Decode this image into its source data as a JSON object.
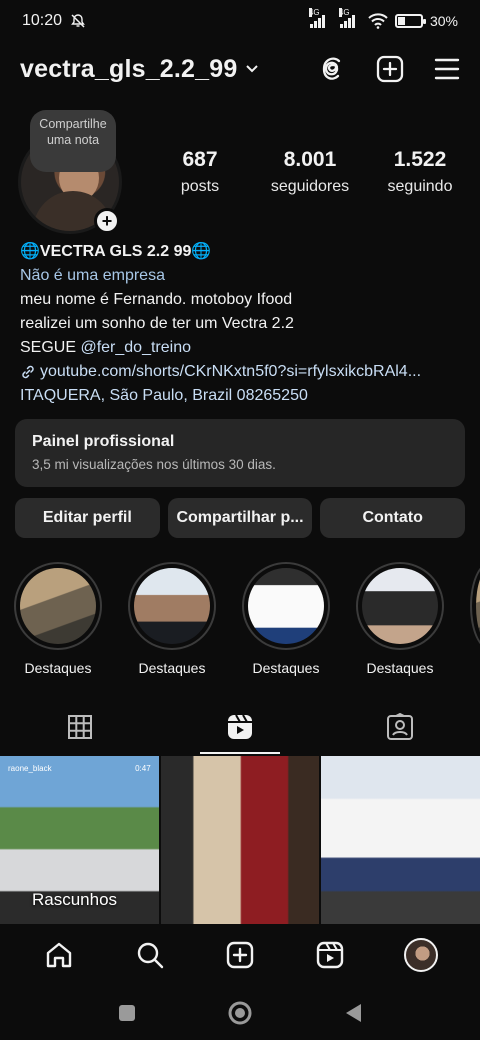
{
  "status_bar": {
    "time": "10:20",
    "network_1": "4G",
    "network_2": "4G",
    "battery_percent": "30%",
    "battery_level": 0.3
  },
  "header": {
    "username": "vectra_gls_2.2_99"
  },
  "profile": {
    "note_text": "Compartilhe uma nota",
    "stats": [
      {
        "value": "687",
        "label": "posts"
      },
      {
        "value": "8.001",
        "label": "seguidores"
      },
      {
        "value": "1.522",
        "label": "seguindo"
      }
    ],
    "bio": {
      "name": "🌐VECTRA GLS 2.2 99🌐",
      "category": "Não é uma empresa",
      "line1": "meu nome é Fernando. motoboy Ifood",
      "line2": "realizei um sonho de ter um Vectra 2.2",
      "follow_prefix": "SEGUE ",
      "mention": "@fer_do_treino",
      "link": "youtube.com/shorts/CKrNKxtn5f0?si=rfylsxikcbRAl4...",
      "address": "ITAQUERA, São Paulo, Brazil 08265250"
    }
  },
  "professional_panel": {
    "title": "Painel profissional",
    "subtitle": "3,5 mi visualizações nos últimos 30 dias."
  },
  "actions": {
    "edit": "Editar perfil",
    "share": "Compartilhar p...",
    "contact": "Contato"
  },
  "highlights": [
    {
      "label": "Destaques"
    },
    {
      "label": "Destaques"
    },
    {
      "label": "Destaques"
    },
    {
      "label": "Destaques"
    }
  ],
  "grid": [
    {
      "tag": "raone_black",
      "duration": "0:47",
      "overlay": "Rascunhos"
    },
    {
      "tag": "",
      "duration": "",
      "overlay": ""
    },
    {
      "tag": "",
      "duration": "",
      "overlay": ""
    }
  ],
  "colors": {
    "background": "#0c0c0c",
    "link": "#c9def5",
    "panel": "#262626",
    "button": "#2b2b2b"
  }
}
